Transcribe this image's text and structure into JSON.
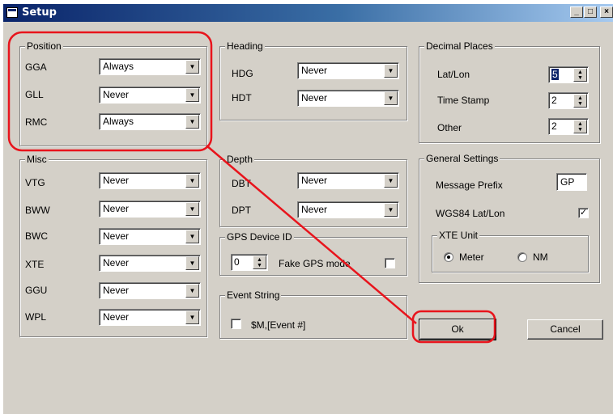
{
  "window": {
    "title": "Setup",
    "min_label": "_",
    "max_label": "□",
    "close_label": "×"
  },
  "position": {
    "legend": "Position",
    "rows": [
      {
        "label": "GGA",
        "value": "Always"
      },
      {
        "label": "GLL",
        "value": "Never"
      },
      {
        "label": "RMC",
        "value": "Always"
      }
    ]
  },
  "heading": {
    "legend": "Heading",
    "rows": [
      {
        "label": "HDG",
        "value": "Never"
      },
      {
        "label": "HDT",
        "value": "Never"
      }
    ]
  },
  "decimal_places": {
    "legend": "Decimal Places",
    "rows": [
      {
        "label": "Lat/Lon",
        "value": "5"
      },
      {
        "label": "Time Stamp",
        "value": "2"
      },
      {
        "label": "Other",
        "value": "2"
      }
    ]
  },
  "misc": {
    "legend": "Misc",
    "rows": [
      {
        "label": "VTG",
        "value": "Never"
      },
      {
        "label": "BWW",
        "value": "Never"
      },
      {
        "label": "BWC",
        "value": "Never"
      },
      {
        "label": "XTE",
        "value": "Never"
      },
      {
        "label": "GGU",
        "value": "Never"
      },
      {
        "label": "WPL",
        "value": "Never"
      }
    ]
  },
  "depth": {
    "legend": "Depth",
    "rows": [
      {
        "label": "DBT",
        "value": "Never"
      },
      {
        "label": "DPT",
        "value": "Never"
      }
    ]
  },
  "gps_device": {
    "legend": "GPS Device ID",
    "id_value": "0",
    "fake_label": "Fake GPS mode",
    "fake_checked": false
  },
  "event_string": {
    "legend": "Event String",
    "label": "$M,[Event #]",
    "checked": false
  },
  "general": {
    "legend": "General Settings",
    "prefix_label": "Message Prefix",
    "prefix_value": "GP",
    "wgs84_label": "WGS84 Lat/Lon",
    "wgs84_checked": true,
    "xte_unit": {
      "legend": "XTE Unit",
      "options": [
        "Meter",
        "NM"
      ],
      "selected": "Meter"
    }
  },
  "buttons": {
    "ok": "Ok",
    "cancel": "Cancel"
  },
  "annotation": {
    "color": "#e8141c"
  },
  "glyphs": {
    "dropdown_arrow": "▼",
    "spin_up": "▲",
    "spin_down": "▼",
    "check_mark": "✓"
  }
}
